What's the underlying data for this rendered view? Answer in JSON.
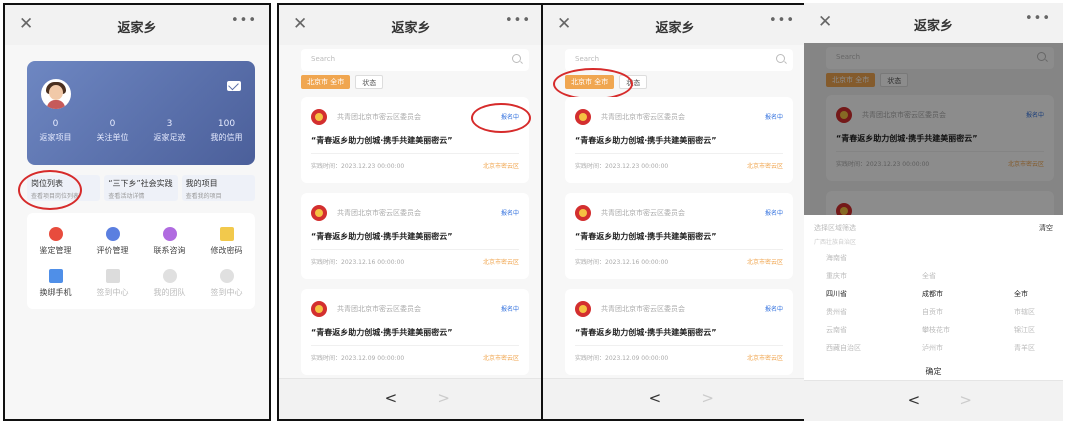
{
  "app_title": "返家乡",
  "close_glyph": "✕",
  "more_glyph": "•••",
  "panel1": {
    "stats": [
      {
        "num": "0",
        "label": "返家项目"
      },
      {
        "num": "0",
        "label": "关注单位"
      },
      {
        "num": "3",
        "label": "返家足迹"
      },
      {
        "num": "100",
        "label": "我的信用"
      }
    ],
    "quick": [
      {
        "title": "岗位列表",
        "sub": "查看项目岗位列表"
      },
      {
        "title": "“三下乡”社会实践",
        "sub": "查看活动详情"
      },
      {
        "title": "我的项目",
        "sub": "查看我的项目"
      }
    ],
    "grid_row1": [
      "鉴定管理",
      "评价管理",
      "联系咨询",
      "修改密码"
    ],
    "grid_row2": [
      "换绑手机",
      "签到中心",
      "我的团队",
      "签到中心"
    ]
  },
  "list": {
    "search_placeholder": "Search",
    "filter_location": "北京市 全市",
    "filter_status": "状态",
    "cards": [
      {
        "org": "共青团北京市密云区委员会",
        "status": "报名中",
        "title": "“青春返乡助力创城·携手共建美丽密云”",
        "time": "实践时间：2023.12.23 00:00:00",
        "location": "北京市密云区"
      },
      {
        "org": "共青团北京市密云区委员会",
        "status": "报名中",
        "title": "“青春返乡助力创城·携手共建美丽密云”",
        "time": "实践时间：2023.12.16 00:00:00",
        "location": "北京市密云区"
      },
      {
        "org": "共青团北京市密云区委员会",
        "status": "报名中",
        "title": "“青春返乡助力创城·携手共建美丽密云”",
        "time": "实践时间：2023.12.09 00:00:00",
        "location": "北京市密云区"
      }
    ],
    "prev": "<",
    "next": ">"
  },
  "picker": {
    "head": "选择区域筛选",
    "clear": "清空",
    "sub": "广西壮族自治区",
    "provinces": [
      "海南省",
      "重庆市",
      "四川省",
      "贵州省",
      "云南省",
      "西藏自治区"
    ],
    "cities": [
      "",
      "全省",
      "成都市",
      "自贡市",
      "攀枝花市",
      "泸州市"
    ],
    "districts": [
      "",
      "",
      "全市",
      "市辖区",
      "锦江区",
      "青羊区"
    ],
    "confirm": "确定"
  },
  "colors": {
    "accent_orange": "#f0a650",
    "highlight_red": "#d62b2b",
    "status_blue": "#2f6fde"
  }
}
